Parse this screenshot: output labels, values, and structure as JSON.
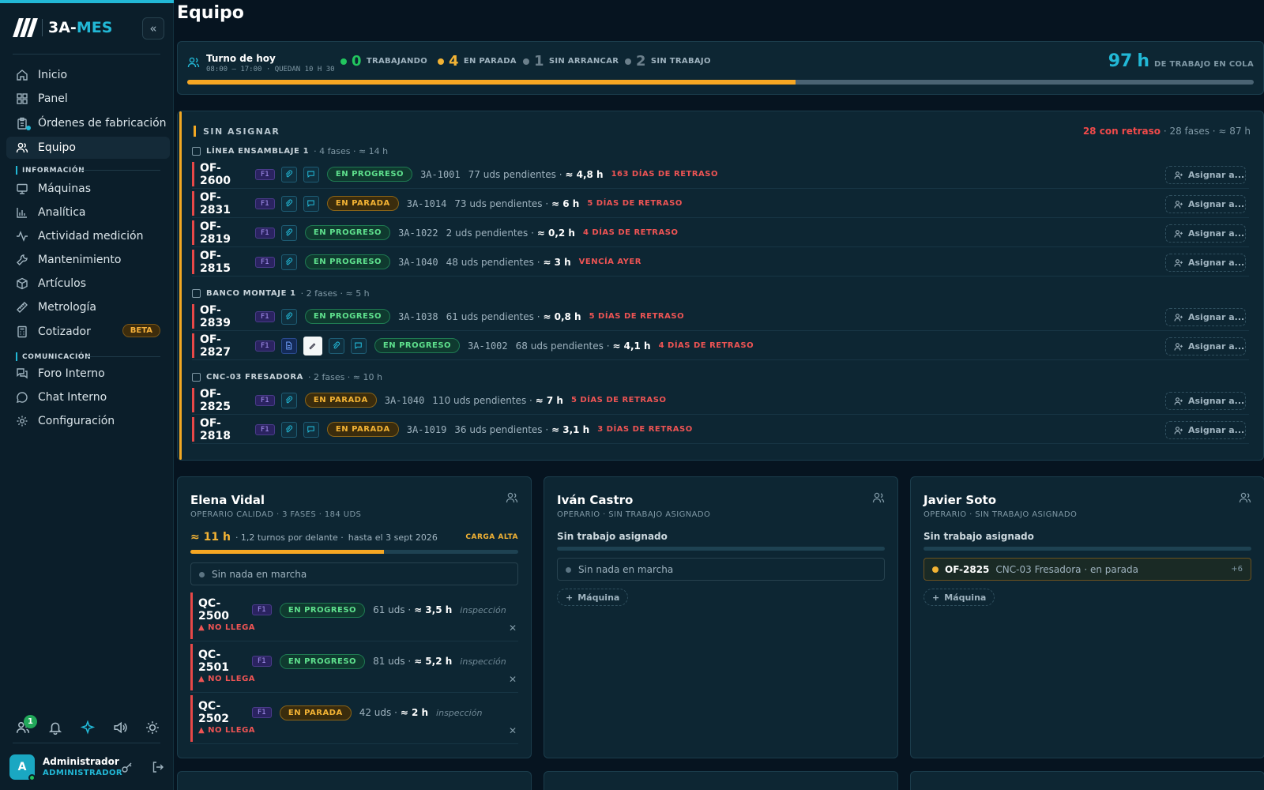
{
  "app": {
    "logo_prefix": "3A-",
    "logo_suffix": "MES"
  },
  "sidebar": {
    "nav": [
      {
        "label": "Inicio",
        "icon": "home-icon"
      },
      {
        "label": "Panel",
        "icon": "grid-icon"
      },
      {
        "label": "Órdenes de fabricación",
        "icon": "clipboard-icon"
      },
      {
        "label": "Equipo",
        "icon": "users-icon"
      }
    ],
    "section_info": "INFORMACIÓN",
    "info": [
      {
        "label": "Máquinas",
        "icon": "monitor-icon"
      },
      {
        "label": "Analítica",
        "icon": "bar-chart-icon"
      },
      {
        "label": "Actividad medición",
        "icon": "activity-icon"
      },
      {
        "label": "Mantenimiento",
        "icon": "wrench-icon"
      },
      {
        "label": "Artículos",
        "icon": "box-icon"
      },
      {
        "label": "Metrología",
        "icon": "ruler-icon"
      },
      {
        "label": "Cotizador",
        "icon": "calculator-icon"
      }
    ],
    "beta": "BETA",
    "section_com": "COMUNICACIÓN",
    "com": [
      {
        "label": "Foro Interno",
        "icon": "forum-icon"
      },
      {
        "label": "Chat Interno",
        "icon": "chat-icon"
      },
      {
        "label": "Configuración",
        "icon": "gear-icon"
      }
    ],
    "notif_count": "1",
    "user": {
      "initial": "A",
      "name": "Administrador",
      "role": "ADMINISTRADOR"
    }
  },
  "page": {
    "title": "Equipo"
  },
  "shift": {
    "title": "Turno de hoy",
    "sub": "08:00 — 17:00 · QUEDAN 10 H 30",
    "stats": [
      {
        "n": "0",
        "label": "TRABAJANDO",
        "color": "#22c55e"
      },
      {
        "n": "4",
        "label": "EN PARADA",
        "color": "#f3b334"
      },
      {
        "n": "1",
        "label": "SIN ARRANCAR",
        "color": "#6b7f8b"
      },
      {
        "n": "2",
        "label": "SIN TRABAJO",
        "color": "#6b7f8b"
      }
    ],
    "queue_hours": "97",
    "queue_unit": "h",
    "queue_label": "DE TRABAJO EN COLA",
    "progress_pct": 57
  },
  "unassigned": {
    "title": "SIN ASIGNAR",
    "late": "28 con retraso",
    "rest": "· 28 fases · ≈ 87 h",
    "assign_label": "Asignar a...",
    "groups": [
      {
        "name": "LÍNEA ENSAMBLAJE 1",
        "meta": "· 4 fases · ≈ 14 h",
        "orders": [
          {
            "id": "OF-2600",
            "phase": "F1",
            "icons": [
              "clip",
              "chat"
            ],
            "status": "EN PROGRESO",
            "st": "prog",
            "ref": "3A-1001",
            "units": "77 uds pendientes ·",
            "hours": "≈ 4,8 h",
            "late": "163 DÍAS DE RETRASO"
          },
          {
            "id": "OF-2831",
            "phase": "F1",
            "icons": [
              "clip",
              "chat"
            ],
            "status": "EN PARADA",
            "st": "stop",
            "ref": "3A-1014",
            "units": "73 uds pendientes ·",
            "hours": "≈ 6 h",
            "late": "5 DÍAS DE RETRASO"
          },
          {
            "id": "OF-2819",
            "phase": "F1",
            "icons": [
              "clip"
            ],
            "status": "EN PROGRESO",
            "st": "prog",
            "ref": "3A-1022",
            "units": "2 uds pendientes ·",
            "hours": "≈ 0,2 h",
            "late": "4 DÍAS DE RETRASO"
          },
          {
            "id": "OF-2815",
            "phase": "F1",
            "icons": [
              "clip"
            ],
            "status": "EN PROGRESO",
            "st": "prog",
            "ref": "3A-1040",
            "units": "48 uds pendientes ·",
            "hours": "≈ 3 h",
            "late": "VENCÍA AYER"
          }
        ]
      },
      {
        "name": "BANCO MONTAJE 1",
        "meta": "· 2 fases · ≈ 5 h",
        "orders": [
          {
            "id": "OF-2839",
            "phase": "F1",
            "icons": [
              "clip"
            ],
            "status": "EN PROGRESO",
            "st": "prog",
            "ref": "3A-1038",
            "units": "61 uds pendientes ·",
            "hours": "≈ 0,8 h",
            "late": "5 DÍAS DE RETRASO"
          },
          {
            "id": "OF-2827",
            "phase": "F1",
            "icons": [
              "doc",
              "tool",
              "clip",
              "chat"
            ],
            "status": "EN PROGRESO",
            "st": "prog",
            "ref": "3A-1002",
            "units": "68 uds pendientes ·",
            "hours": "≈ 4,1 h",
            "late": "4 DÍAS DE RETRASO"
          }
        ]
      },
      {
        "name": "CNC-03 FRESADORA",
        "meta": "· 2 fases · ≈ 10 h",
        "orders": [
          {
            "id": "OF-2825",
            "phase": "F1",
            "icons": [
              "clip"
            ],
            "status": "EN PARADA",
            "st": "stop",
            "ref": "3A-1040",
            "units": "110 uds pendientes ·",
            "hours": "≈ 7 h",
            "late": "5 DÍAS DE RETRASO"
          },
          {
            "id": "OF-2818",
            "phase": "F1",
            "icons": [
              "clip",
              "chat"
            ],
            "status": "EN PARADA",
            "st": "stop",
            "ref": "3A-1019",
            "units": "36 uds pendientes ·",
            "hours": "≈ 3,1 h",
            "late": "3 DÍAS DE RETRASO"
          }
        ]
      }
    ]
  },
  "cards": {
    "elena": {
      "name": "Elena Vidal",
      "role": "OPERARIO CALIDAD · 3 FASES · 184 UDS",
      "hours": "≈ 11 h",
      "shifts": "· 1,2 turnos por delante ·",
      "until": "hasta el 3 sept 2026",
      "load": "CARGA ALTA",
      "load_pct": 59,
      "nothing": "Sin nada en marcha",
      "orders": [
        {
          "id": "QC-2500",
          "phase": "F1",
          "status": "EN PROGRESO",
          "st": "prog",
          "units": "61 uds ·",
          "hours": "≈ 3,5 h",
          "kind": "inspección",
          "warn": "▲ NO LLEGA"
        },
        {
          "id": "QC-2501",
          "phase": "F1",
          "status": "EN PROGRESO",
          "st": "prog",
          "units": "81 uds ·",
          "hours": "≈ 5,2 h",
          "kind": "inspección",
          "warn": "▲ NO LLEGA"
        },
        {
          "id": "QC-2502",
          "phase": "F1",
          "status": "EN PARADA",
          "st": "stop",
          "units": "42 uds ·",
          "hours": "≈ 2 h",
          "kind": "inspección",
          "warn": "▲ NO LLEGA"
        }
      ]
    },
    "ivan": {
      "name": "Iván Castro",
      "role": "OPERARIO · SIN TRABAJO ASIGNADO",
      "no_work": "Sin trabajo asignado",
      "nothing": "Sin nada en marcha",
      "machine": "Máquina"
    },
    "javier": {
      "name": "Javier Soto",
      "role": "OPERARIO · SIN TRABAJO ASIGNADO",
      "no_work": "Sin trabajo asignado",
      "run_id": "OF-2825",
      "run_desc": "CNC-03 Fresadora · en parada",
      "run_more": "+6",
      "machine": "Máquina"
    }
  }
}
